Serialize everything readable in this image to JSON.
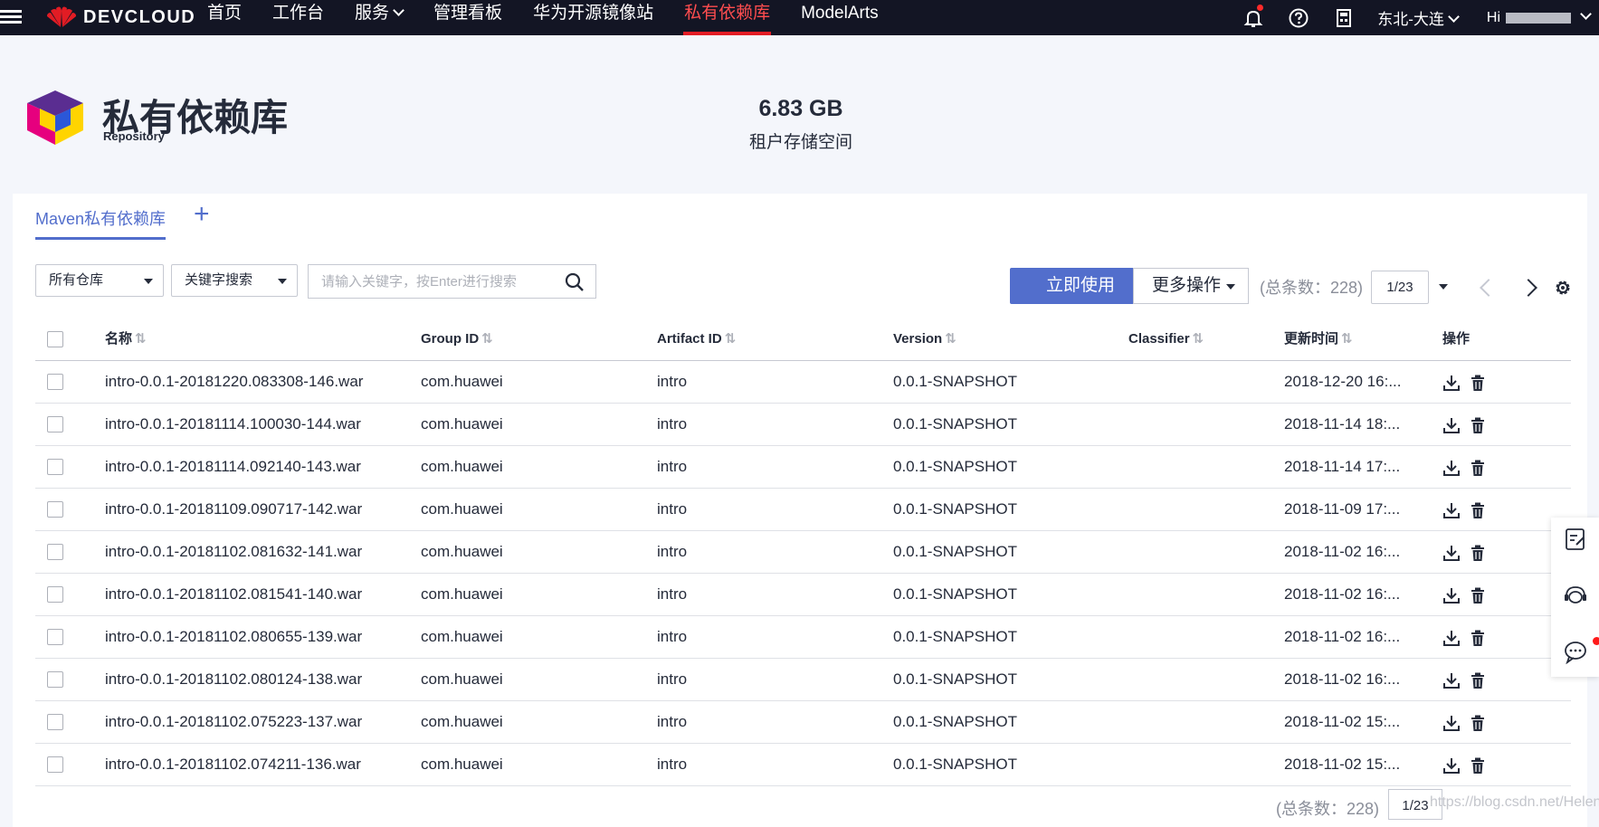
{
  "topbar": {
    "brand": "DEVCLOUD",
    "nav": [
      "首页",
      "工作台",
      "服务",
      "管理看板",
      "华为开源镜像站",
      "私有依赖库",
      "ModelArts"
    ],
    "active_nav": "私有依赖库",
    "region": "东北-大连",
    "greeting": "Hi"
  },
  "header": {
    "title": "私有依赖库",
    "subtitle": "Repository",
    "storage_value": "6.83 GB",
    "storage_label": "租户存储空间"
  },
  "tabs": {
    "active": "Maven私有依赖库",
    "add": "+"
  },
  "filters": {
    "repo_select": "所有仓库",
    "search_type": "关键字搜索",
    "search_placeholder": "请输入关键字，按Enter进行搜索"
  },
  "toolbar": {
    "use_now": "立即使用",
    "more_actions": "更多操作",
    "total": "(总条数：228)",
    "page": "1/23"
  },
  "table": {
    "columns": [
      "名称",
      "Group ID",
      "Artifact ID",
      "Version",
      "Classifier",
      "更新时间",
      "操作"
    ],
    "rows": [
      {
        "name": "intro-0.0.1-20181220.083308-146.war",
        "group": "com.huawei",
        "artifact": "intro",
        "version": "0.0.1-SNAPSHOT",
        "classifier": "",
        "time": "2018-12-20 16:..."
      },
      {
        "name": "intro-0.0.1-20181114.100030-144.war",
        "group": "com.huawei",
        "artifact": "intro",
        "version": "0.0.1-SNAPSHOT",
        "classifier": "",
        "time": "2018-11-14 18:..."
      },
      {
        "name": "intro-0.0.1-20181114.092140-143.war",
        "group": "com.huawei",
        "artifact": "intro",
        "version": "0.0.1-SNAPSHOT",
        "classifier": "",
        "time": "2018-11-14 17:..."
      },
      {
        "name": "intro-0.0.1-20181109.090717-142.war",
        "group": "com.huawei",
        "artifact": "intro",
        "version": "0.0.1-SNAPSHOT",
        "classifier": "",
        "time": "2018-11-09 17:..."
      },
      {
        "name": "intro-0.0.1-20181102.081632-141.war",
        "group": "com.huawei",
        "artifact": "intro",
        "version": "0.0.1-SNAPSHOT",
        "classifier": "",
        "time": "2018-11-02 16:..."
      },
      {
        "name": "intro-0.0.1-20181102.081541-140.war",
        "group": "com.huawei",
        "artifact": "intro",
        "version": "0.0.1-SNAPSHOT",
        "classifier": "",
        "time": "2018-11-02 16:..."
      },
      {
        "name": "intro-0.0.1-20181102.080655-139.war",
        "group": "com.huawei",
        "artifact": "intro",
        "version": "0.0.1-SNAPSHOT",
        "classifier": "",
        "time": "2018-11-02 16:..."
      },
      {
        "name": "intro-0.0.1-20181102.080124-138.war",
        "group": "com.huawei",
        "artifact": "intro",
        "version": "0.0.1-SNAPSHOT",
        "classifier": "",
        "time": "2018-11-02 16:..."
      },
      {
        "name": "intro-0.0.1-20181102.075223-137.war",
        "group": "com.huawei",
        "artifact": "intro",
        "version": "0.0.1-SNAPSHOT",
        "classifier": "",
        "time": "2018-11-02 15:..."
      },
      {
        "name": "intro-0.0.1-20181102.074211-136.war",
        "group": "com.huawei",
        "artifact": "intro",
        "version": "0.0.1-SNAPSHOT",
        "classifier": "",
        "time": "2018-11-02 15:..."
      }
    ]
  },
  "footer": {
    "total": "(总条数：228)",
    "page": "1/23",
    "watermark": "https://blog.csdn.net/HelenaA"
  },
  "icons": {
    "download": "download-icon",
    "delete": "trash-icon",
    "sort": "sort-icon",
    "feedback": "edit-note-icon",
    "support": "headset-icon",
    "chat": "chat-bubble-icon"
  },
  "colors": {
    "topbar": "#131524",
    "accent": "#526ecc",
    "active_nav": "#e21c24"
  }
}
